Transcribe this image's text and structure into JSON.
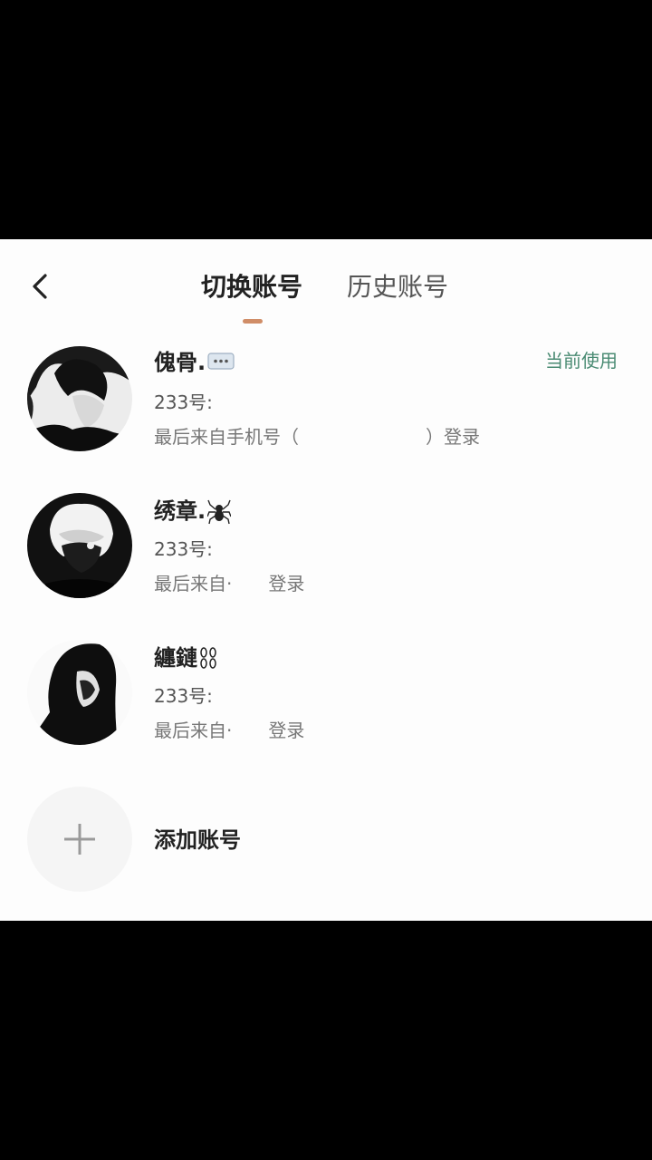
{
  "header": {
    "back_icon": "chevron-left-icon",
    "tabs": [
      {
        "label": "切换账号",
        "active": true
      },
      {
        "label": "历史账号",
        "active": false
      }
    ],
    "accent_color": "#d08d67"
  },
  "accounts": [
    {
      "name": "傀骨.",
      "badge_icon": "speech-bubble-icon",
      "uid_label": "233号:",
      "login_text": "最后来自手机号（　　　　　　　）登录",
      "status": "当前使用"
    },
    {
      "name": "绣章.",
      "badge_icon": "spider-icon",
      "uid_label": "233号:",
      "login_text": "最后来自·　　登录"
    },
    {
      "name": "纏鏈",
      "badge_icon": "chain-icon",
      "uid_label": "233号:",
      "login_text": "最后来自·　　登录"
    }
  ],
  "add_account": {
    "label": "添加账号",
    "icon": "plus-icon"
  },
  "colors": {
    "status_green": "#4a8b73",
    "sheet_bg": "#fdfdfd"
  }
}
